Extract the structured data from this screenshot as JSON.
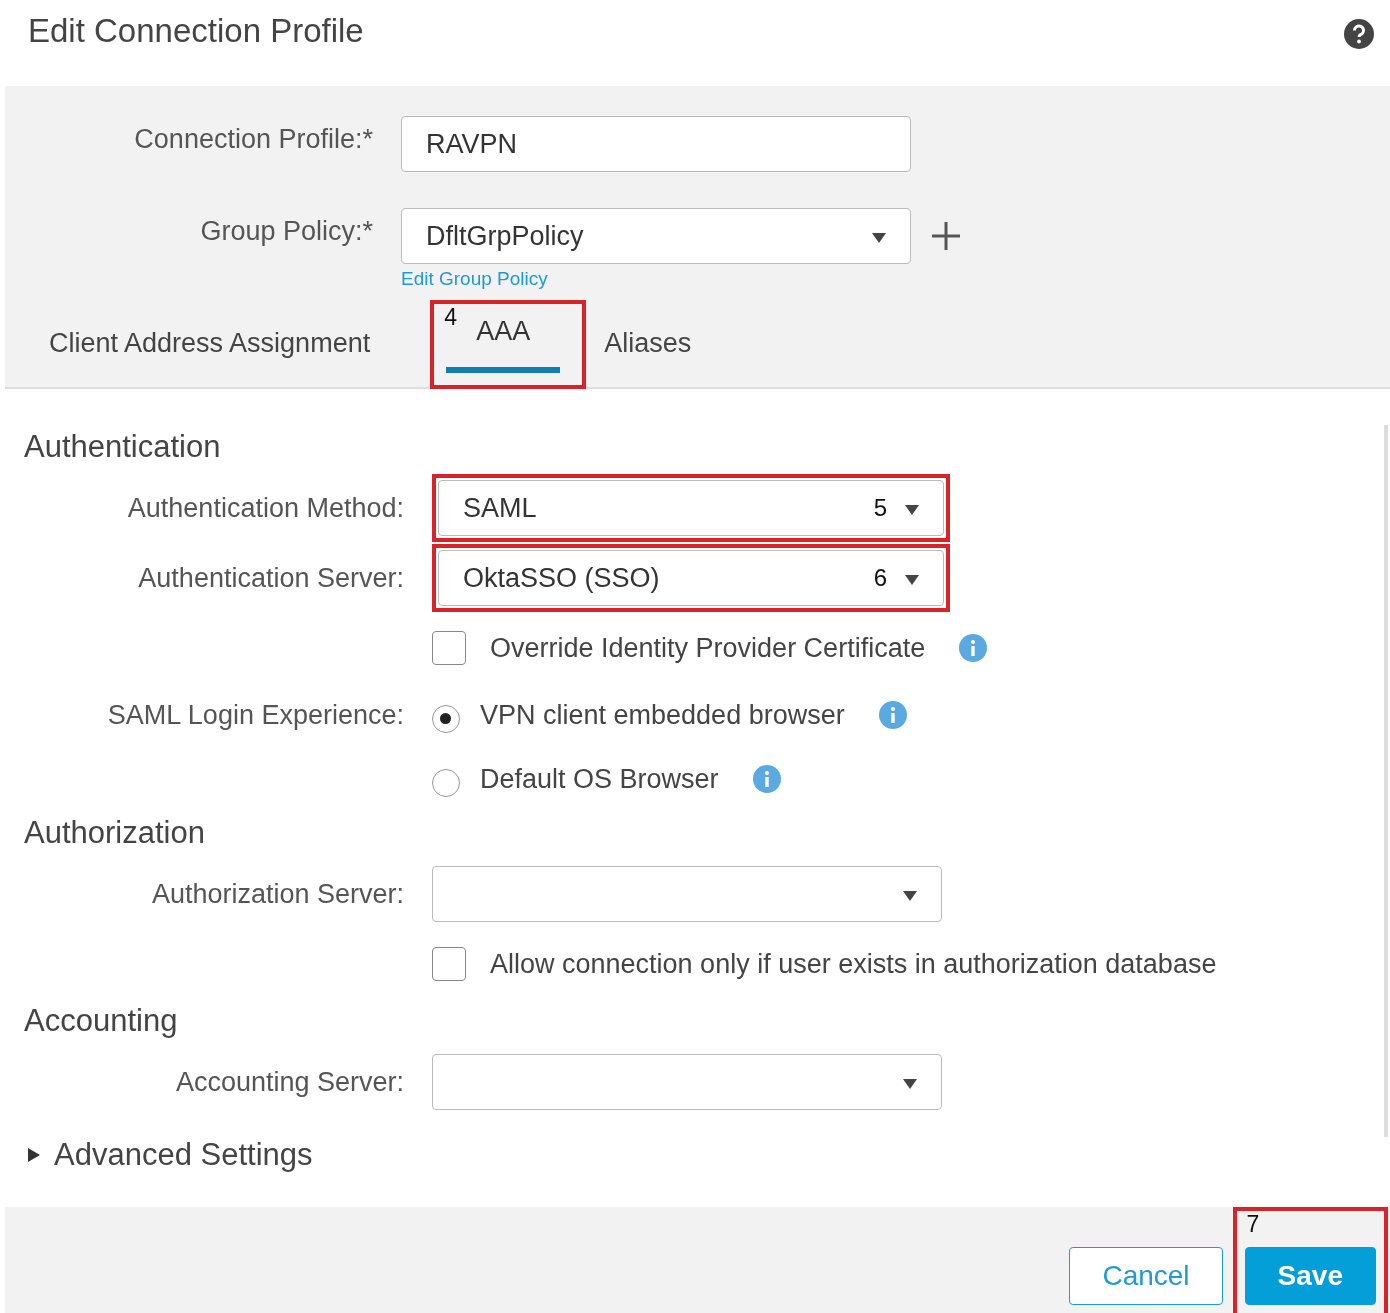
{
  "dialog": {
    "title": "Edit Connection Profile"
  },
  "top_fields": [
    {
      "kind": "text",
      "label": "Connection Profile:*",
      "value": "RAVPN"
    },
    {
      "kind": "select",
      "label": "Group Policy:*",
      "value": "DfltGrpPolicy",
      "link": "Edit Group Policy"
    }
  ],
  "tabs": [
    {
      "label": "Client Address Assignment",
      "selected": false
    },
    {
      "label": "AAA",
      "selected": true,
      "callout": "4"
    },
    {
      "label": "Aliases",
      "selected": false
    }
  ],
  "sections": [
    {
      "heading": "Authentication",
      "rows": [
        {
          "kind": "select",
          "label": "Authentication Method:",
          "value": "SAML",
          "callout": "5"
        },
        {
          "kind": "select",
          "label": "Authentication Server:",
          "value": "OktaSSO (SSO)",
          "callout": "6"
        },
        {
          "kind": "checkbox",
          "text": "Override Identity Provider Certificate",
          "checked": false,
          "info": true
        },
        {
          "kind": "radio",
          "label": "SAML Login Experience:",
          "options": [
            {
              "text": "VPN client embedded browser",
              "selected": true,
              "info": true
            },
            {
              "text": "Default OS Browser",
              "selected": false,
              "info": true
            }
          ]
        }
      ]
    },
    {
      "heading": "Authorization",
      "rows": [
        {
          "kind": "select",
          "label": "Authorization Server:"
        },
        {
          "kind": "checkbox",
          "text": "Allow connection only if user exists in authorization database",
          "checked": false,
          "info": false
        }
      ]
    },
    {
      "heading": "Accounting",
      "rows": [
        {
          "kind": "select",
          "label": "Accounting Server:"
        }
      ]
    }
  ],
  "advanced": {
    "label": "Advanced Settings",
    "expanded": false
  },
  "buttons": [
    {
      "kind": "secondary",
      "label": "Cancel"
    },
    {
      "kind": "primary",
      "label": "Save",
      "callout": "7"
    }
  ]
}
